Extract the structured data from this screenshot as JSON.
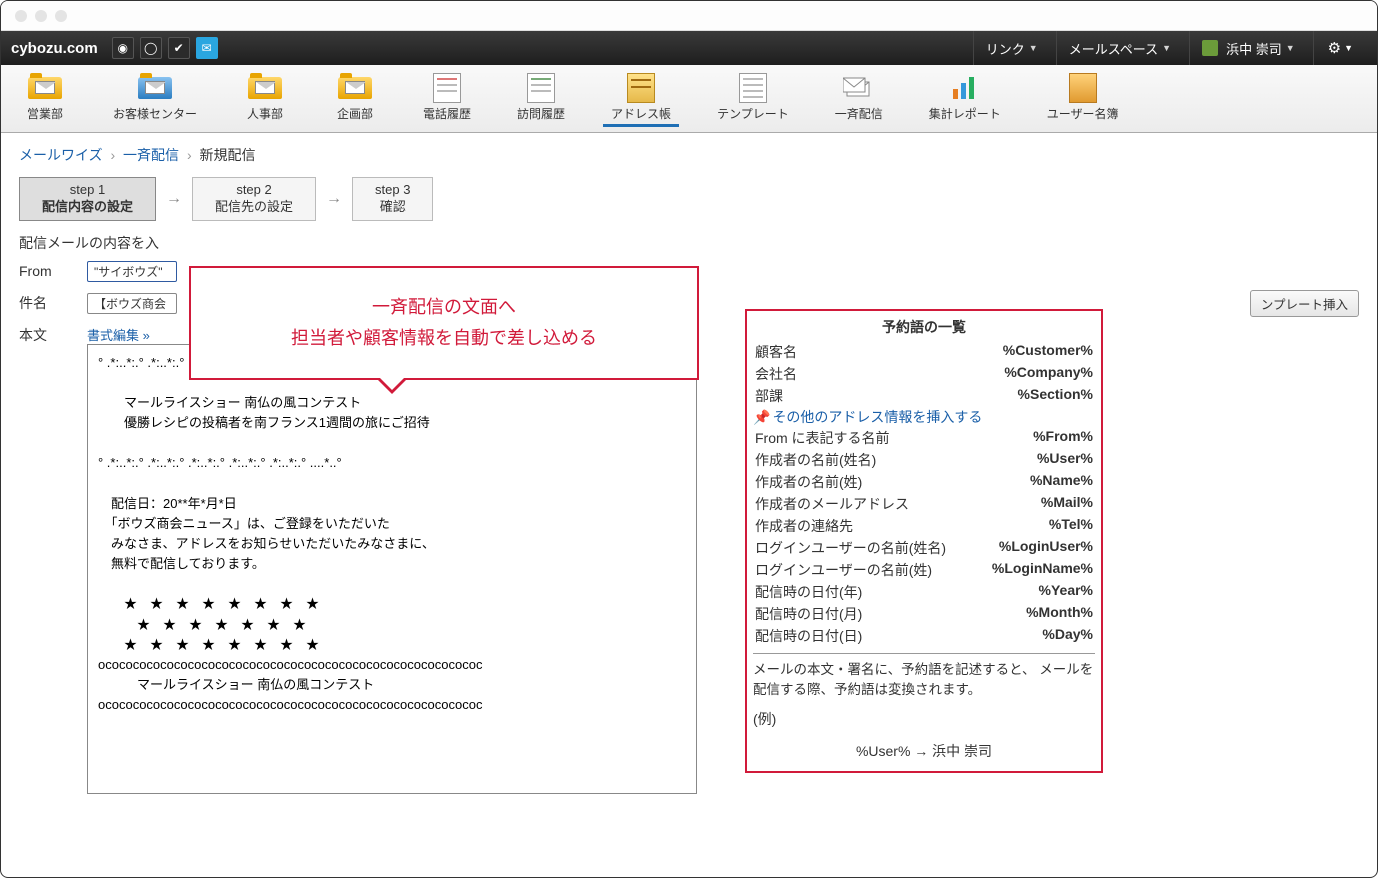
{
  "brand": "cybozu.com",
  "topmenus": {
    "link": "リンク",
    "mailspace": "メールスペース",
    "user": "浜中 崇司"
  },
  "toolbar": [
    {
      "label": "営業部"
    },
    {
      "label": "お客様センター"
    },
    {
      "label": "人事部"
    },
    {
      "label": "企画部"
    },
    {
      "label": "電話履歴"
    },
    {
      "label": "訪問履歴"
    },
    {
      "label": "アドレス帳"
    },
    {
      "label": "テンプレート"
    },
    {
      "label": "一斉配信"
    },
    {
      "label": "集計レポート"
    },
    {
      "label": "ユーザー名簿"
    }
  ],
  "breadcrumb": {
    "root": "メールワイズ",
    "mid": "一斉配信",
    "leaf": "新規配信"
  },
  "steps": [
    {
      "num": "step 1",
      "label": "配信内容の設定"
    },
    {
      "num": "step 2",
      "label": "配信先の設定"
    },
    {
      "num": "step 3",
      "label": "確認"
    }
  ],
  "intro": "配信メールの内容を入",
  "form": {
    "from_label": "From",
    "from_value": "\"サイボウズ\"",
    "subject_label": "件名",
    "subject_value": "【ボウズ商会",
    "body_label": "本文",
    "format_link": "書式編集 »",
    "template_button": "ンプレート挿入"
  },
  "body_text": "° .*:..*:.° .*:..*:.° .*:..*:.° .*:..*:.° .*:..*:.° ....*..°\n\n　　マールライスショー 南仏の風コンテスト\n　　優勝レシピの投稿者を南フランス1週間の旅にご招待\n\n° .*:..*:.° .*:..*:.° .*:..*:.° .*:..*:.° .*:..*:.° ....*..°\n\n　配信日：20**年*月*日\n　「ボウズ商会ニュース」は、ご登録をいただいた\n　みなさま、アドレスをお知らせいただいたみなさまに、\n　無料で配信しております。\n\n　　★　★　★　★　★　★　★　★\n　　　★　★　★　★　★　★　★\n　　★　★　★　★　★　★　★　★\nococococococococococococococococococococococococococococ\n　　　マールライスショー 南仏の風コンテスト\nococococococococococococococococococococococococococococ",
  "callout": {
    "line1": "一斉配信の文面へ",
    "line2": "担当者や顧客情報を自動で差し込める"
  },
  "reserved": {
    "title": "予約語の一覧",
    "rows": [
      {
        "label": "顧客名",
        "token": "%Customer%"
      },
      {
        "label": "会社名",
        "token": "%Company%"
      },
      {
        "label": "部課",
        "token": "%Section%"
      }
    ],
    "insert_link": "その他のアドレス情報を挿入する",
    "rows2": [
      {
        "label": "From に表記する名前",
        "token": "%From%"
      },
      {
        "label": "作成者の名前(姓名)",
        "token": "%User%"
      },
      {
        "label": "作成者の名前(姓)",
        "token": "%Name%"
      },
      {
        "label": "作成者のメールアドレス",
        "token": "%Mail%"
      },
      {
        "label": "作成者の連絡先",
        "token": "%Tel%"
      },
      {
        "label": "ログインユーザーの名前(姓名)",
        "token": "%LoginUser%"
      },
      {
        "label": "ログインユーザーの名前(姓)",
        "token": "%LoginName%"
      },
      {
        "label": "配信時の日付(年)",
        "token": "%Year%"
      },
      {
        "label": "配信時の日付(月)",
        "token": "%Month%"
      },
      {
        "label": "配信時の日付(日)",
        "token": "%Day%"
      }
    ],
    "note": "メールの本文・署名に、予約語を記述すると、\nメールを配信する際、予約語は変換されます。",
    "example_label": "(例)",
    "example": "%User% → 浜中 崇司"
  }
}
